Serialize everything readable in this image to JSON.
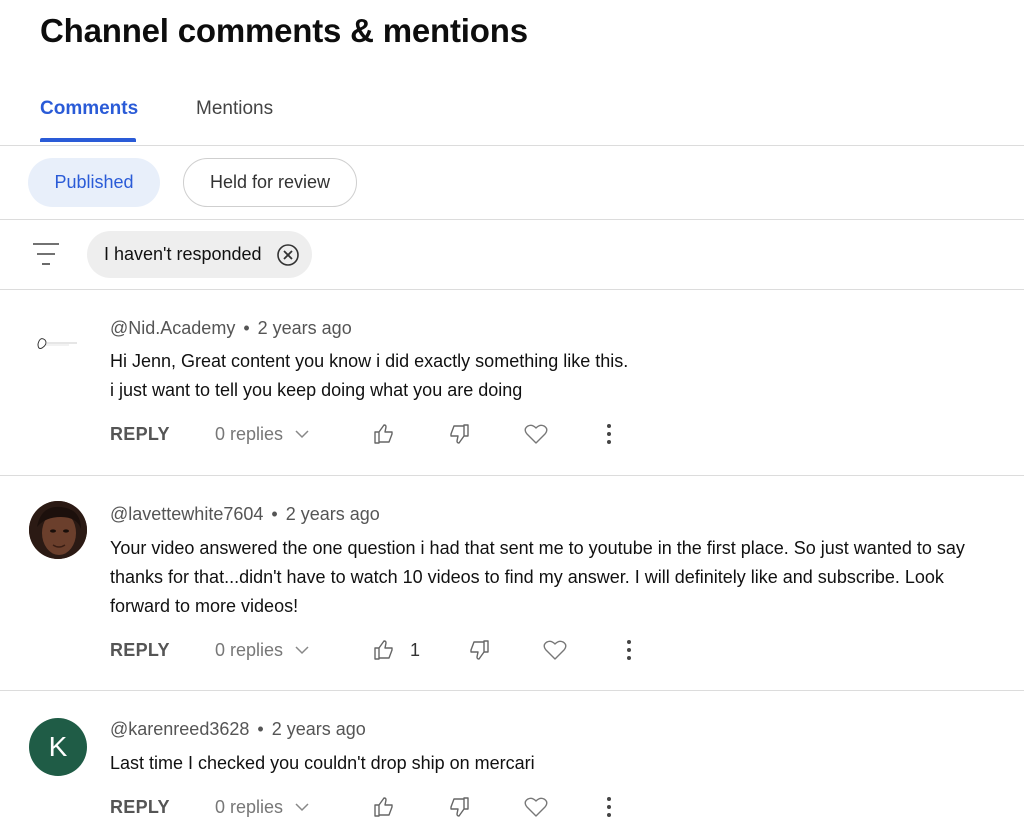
{
  "page": {
    "title": "Channel comments & mentions"
  },
  "tabs": [
    {
      "label": "Comments",
      "active": true
    },
    {
      "label": "Mentions",
      "active": false
    }
  ],
  "subtabs": [
    {
      "label": "Published",
      "selected": true
    },
    {
      "label": "Held for review",
      "selected": false
    }
  ],
  "filter": {
    "icon": "filter-icon",
    "chip_label": "I haven't responded",
    "chip_close_icon": "close-circle-icon"
  },
  "colors": {
    "accent": "#2a5bd7",
    "accent_bg": "#e8effa",
    "avatar_k": "#1f5c46"
  },
  "comments": [
    {
      "author": "@Nid.Academy",
      "time": "2 years ago",
      "avatar": "Nid Academy logo",
      "text_lines": [
        "Hi Jenn, Great content you know i did exactly something like this.",
        "i just want to tell you keep doing what you are doing"
      ],
      "reply_label": "REPLY",
      "replies_label": "0 replies",
      "likes": ""
    },
    {
      "author": "@lavettewhite7604",
      "time": "2 years ago",
      "avatar": "photo",
      "text_lines": [
        "Your video answered the one question i had that sent me to youtube in the first place. So just wanted to say",
        "thanks for that...didn't have to watch 10 videos to find my answer. I will definitely like and subscribe. Look",
        "forward to more videos!"
      ],
      "reply_label": "REPLY",
      "replies_label": "0 replies",
      "likes": "1"
    },
    {
      "author": "@karenreed3628",
      "time": "2 years ago",
      "avatar": "K",
      "text_lines": [
        "Last time I checked you couldn't drop ship on mercari"
      ],
      "reply_label": "REPLY",
      "replies_label": "0 replies",
      "likes": ""
    }
  ]
}
